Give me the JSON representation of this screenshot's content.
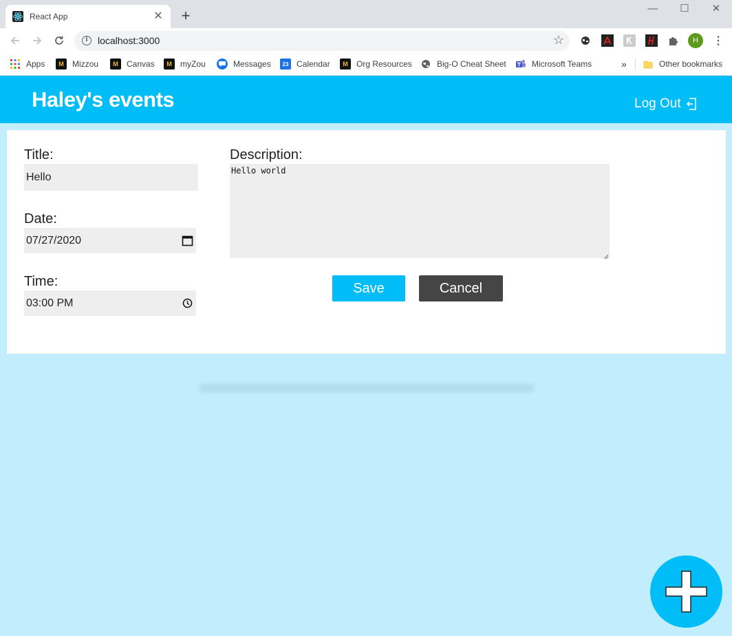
{
  "browser": {
    "tab_title": "React App",
    "tab_close": "✕",
    "new_tab": "+",
    "url": "localhost:3000",
    "profile_initial": "H",
    "window_controls": {
      "minimize": "—",
      "maximize": "☐",
      "close": "✕"
    },
    "bookmarks": [
      {
        "label": "Apps",
        "icon": "apps-grid-icon"
      },
      {
        "label": "Mizzou",
        "icon": "mizzou-tiger-icon"
      },
      {
        "label": "Canvas",
        "icon": "mizzou-tiger-icon"
      },
      {
        "label": "myZou",
        "icon": "mizzou-tiger-icon"
      },
      {
        "label": "Messages",
        "icon": "messages-icon"
      },
      {
        "label": "Calendar",
        "icon": "calendar-icon",
        "badge": "23"
      },
      {
        "label": "Org Resources",
        "icon": "mizzou-tiger-icon"
      },
      {
        "label": "Big-O Cheat Sheet",
        "icon": "globe-icon"
      },
      {
        "label": "Microsoft Teams",
        "icon": "teams-icon"
      }
    ],
    "bookmarks_overflow": "»",
    "other_bookmarks": "Other bookmarks"
  },
  "header": {
    "title": "Haley's events",
    "logout_label": "Log Out"
  },
  "form": {
    "title_label": "Title:",
    "title_value": "Hello",
    "date_label": "Date:",
    "date_value": "07/27/2020",
    "time_label": "Time:",
    "time_value": "03:00 PM",
    "description_label": "Description:",
    "description_value": "Hello world",
    "save_label": "Save",
    "cancel_label": "Cancel"
  },
  "colors": {
    "accent": "#00bdf8",
    "page_bg": "#c2edfd",
    "cancel_bg": "#454545",
    "field_bg": "#eeeeee"
  }
}
